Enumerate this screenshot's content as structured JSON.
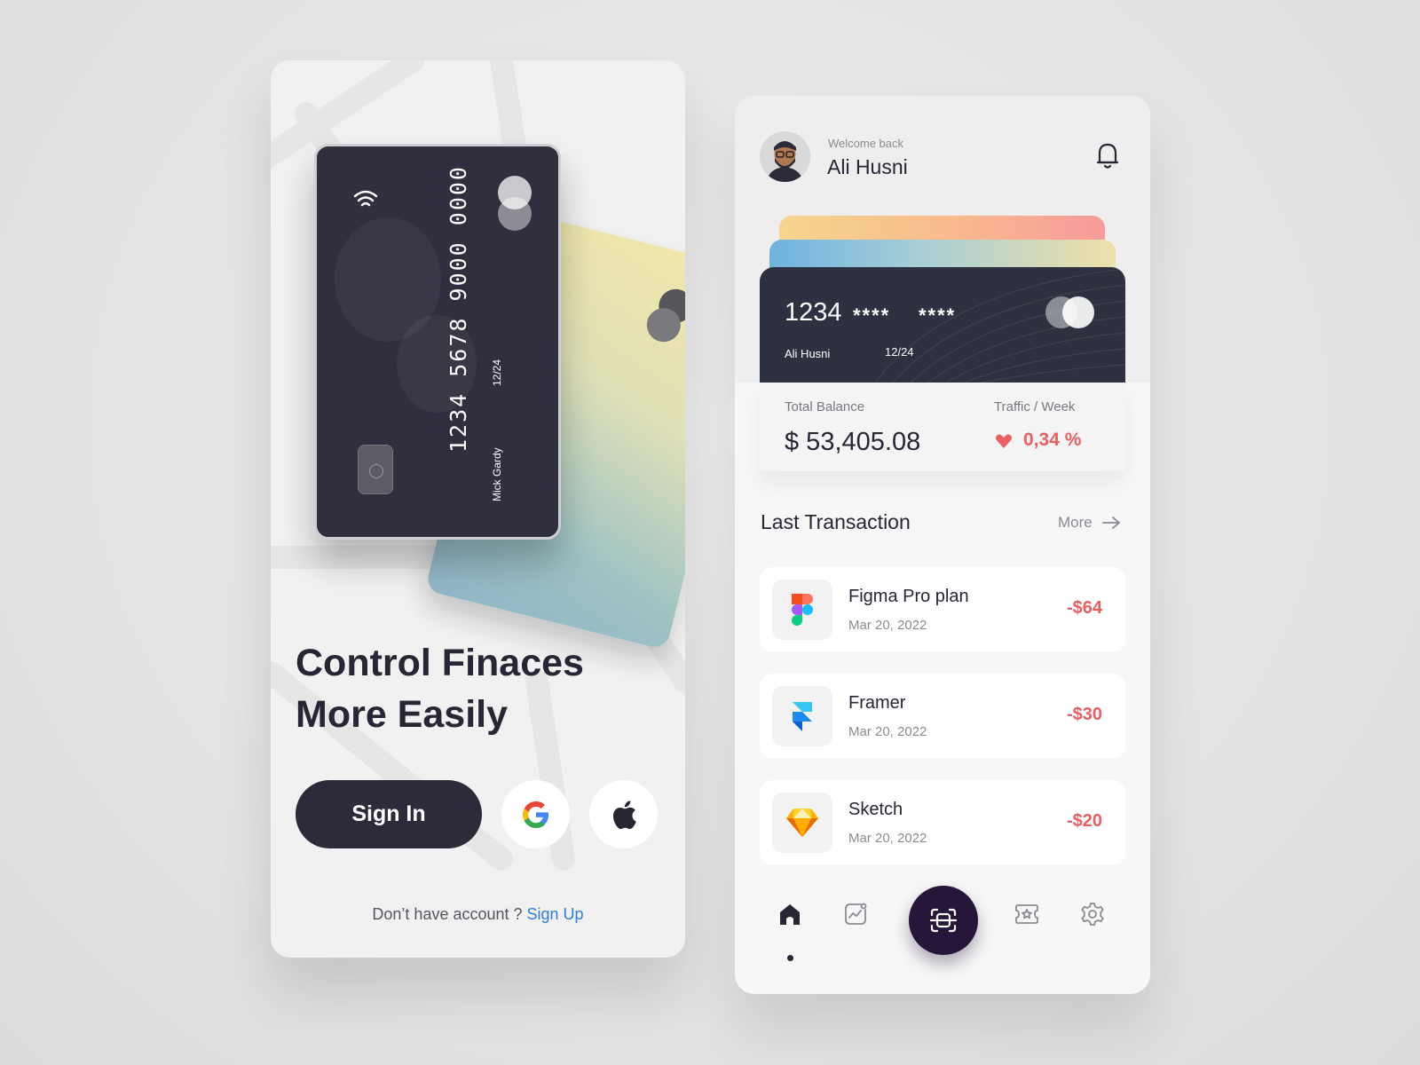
{
  "signin_screen": {
    "card_front": {
      "number": "1234 5678 9000 0000",
      "holder": "Mick Gardy",
      "expiry": "12/24"
    },
    "card_back": {
      "number_fragment": "0000"
    },
    "headline_line1": "Control Finaces",
    "headline_line2": "More Easily",
    "signin_label": "Sign In",
    "signup_prompt": "Don’t have account ? ",
    "signup_link": "Sign Up"
  },
  "dashboard": {
    "welcome": "Welcome back",
    "user_name": "Ali Husni",
    "card": {
      "number_visible": "1234",
      "mask1": "****",
      "mask2": "****",
      "holder": "Ali Husni",
      "expiry": "12/24"
    },
    "balance": {
      "label": "Total Balance",
      "value": "$ 53,405.08"
    },
    "traffic": {
      "label": "Traffic / Week",
      "value": "0,34 %"
    },
    "transactions_title": "Last Transaction",
    "more_label": "More",
    "transactions": [
      {
        "name": "Figma Pro plan",
        "date": "Mar 20, 2022",
        "amount": "-$64",
        "icon": "figma-icon"
      },
      {
        "name": "Framer",
        "date": "Mar 20, 2022",
        "amount": "-$30",
        "icon": "framer-icon"
      },
      {
        "name": "Sketch",
        "date": "Mar 20, 2022",
        "amount": "-$20",
        "icon": "sketch-icon"
      }
    ],
    "nav": [
      "home-icon",
      "chart-icon",
      "scan-icon",
      "rewards-icon",
      "settings-icon"
    ],
    "active_nav": "home-icon"
  },
  "colors": {
    "dark": "#262634",
    "accent_red": "#ea5f5f",
    "link_blue": "#2d7fd6",
    "scan_button": "#25163a"
  }
}
